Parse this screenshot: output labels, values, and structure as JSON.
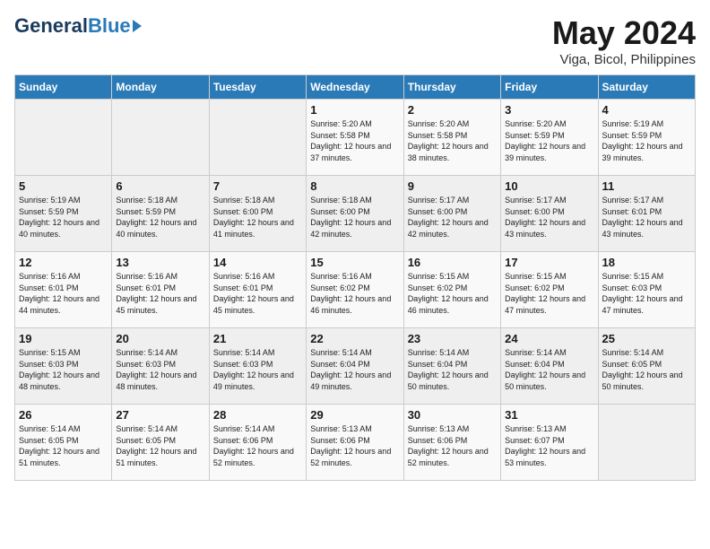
{
  "header": {
    "logo_general": "General",
    "logo_blue": "Blue",
    "month_title": "May 2024",
    "location": "Viga, Bicol, Philippines"
  },
  "calendar": {
    "weekdays": [
      "Sunday",
      "Monday",
      "Tuesday",
      "Wednesday",
      "Thursday",
      "Friday",
      "Saturday"
    ],
    "weeks": [
      [
        {
          "day": "",
          "sunrise": "",
          "sunset": "",
          "daylight": ""
        },
        {
          "day": "",
          "sunrise": "",
          "sunset": "",
          "daylight": ""
        },
        {
          "day": "",
          "sunrise": "",
          "sunset": "",
          "daylight": ""
        },
        {
          "day": "1",
          "sunrise": "5:20 AM",
          "sunset": "5:58 PM",
          "daylight": "12 hours and 37 minutes."
        },
        {
          "day": "2",
          "sunrise": "5:20 AM",
          "sunset": "5:58 PM",
          "daylight": "12 hours and 38 minutes."
        },
        {
          "day": "3",
          "sunrise": "5:20 AM",
          "sunset": "5:59 PM",
          "daylight": "12 hours and 39 minutes."
        },
        {
          "day": "4",
          "sunrise": "5:19 AM",
          "sunset": "5:59 PM",
          "daylight": "12 hours and 39 minutes."
        }
      ],
      [
        {
          "day": "5",
          "sunrise": "5:19 AM",
          "sunset": "5:59 PM",
          "daylight": "12 hours and 40 minutes."
        },
        {
          "day": "6",
          "sunrise": "5:18 AM",
          "sunset": "5:59 PM",
          "daylight": "12 hours and 40 minutes."
        },
        {
          "day": "7",
          "sunrise": "5:18 AM",
          "sunset": "6:00 PM",
          "daylight": "12 hours and 41 minutes."
        },
        {
          "day": "8",
          "sunrise": "5:18 AM",
          "sunset": "6:00 PM",
          "daylight": "12 hours and 42 minutes."
        },
        {
          "day": "9",
          "sunrise": "5:17 AM",
          "sunset": "6:00 PM",
          "daylight": "12 hours and 42 minutes."
        },
        {
          "day": "10",
          "sunrise": "5:17 AM",
          "sunset": "6:00 PM",
          "daylight": "12 hours and 43 minutes."
        },
        {
          "day": "11",
          "sunrise": "5:17 AM",
          "sunset": "6:01 PM",
          "daylight": "12 hours and 43 minutes."
        }
      ],
      [
        {
          "day": "12",
          "sunrise": "5:16 AM",
          "sunset": "6:01 PM",
          "daylight": "12 hours and 44 minutes."
        },
        {
          "day": "13",
          "sunrise": "5:16 AM",
          "sunset": "6:01 PM",
          "daylight": "12 hours and 45 minutes."
        },
        {
          "day": "14",
          "sunrise": "5:16 AM",
          "sunset": "6:01 PM",
          "daylight": "12 hours and 45 minutes."
        },
        {
          "day": "15",
          "sunrise": "5:16 AM",
          "sunset": "6:02 PM",
          "daylight": "12 hours and 46 minutes."
        },
        {
          "day": "16",
          "sunrise": "5:15 AM",
          "sunset": "6:02 PM",
          "daylight": "12 hours and 46 minutes."
        },
        {
          "day": "17",
          "sunrise": "5:15 AM",
          "sunset": "6:02 PM",
          "daylight": "12 hours and 47 minutes."
        },
        {
          "day": "18",
          "sunrise": "5:15 AM",
          "sunset": "6:03 PM",
          "daylight": "12 hours and 47 minutes."
        }
      ],
      [
        {
          "day": "19",
          "sunrise": "5:15 AM",
          "sunset": "6:03 PM",
          "daylight": "12 hours and 48 minutes."
        },
        {
          "day": "20",
          "sunrise": "5:14 AM",
          "sunset": "6:03 PM",
          "daylight": "12 hours and 48 minutes."
        },
        {
          "day": "21",
          "sunrise": "5:14 AM",
          "sunset": "6:03 PM",
          "daylight": "12 hours and 49 minutes."
        },
        {
          "day": "22",
          "sunrise": "5:14 AM",
          "sunset": "6:04 PM",
          "daylight": "12 hours and 49 minutes."
        },
        {
          "day": "23",
          "sunrise": "5:14 AM",
          "sunset": "6:04 PM",
          "daylight": "12 hours and 50 minutes."
        },
        {
          "day": "24",
          "sunrise": "5:14 AM",
          "sunset": "6:04 PM",
          "daylight": "12 hours and 50 minutes."
        },
        {
          "day": "25",
          "sunrise": "5:14 AM",
          "sunset": "6:05 PM",
          "daylight": "12 hours and 50 minutes."
        }
      ],
      [
        {
          "day": "26",
          "sunrise": "5:14 AM",
          "sunset": "6:05 PM",
          "daylight": "12 hours and 51 minutes."
        },
        {
          "day": "27",
          "sunrise": "5:14 AM",
          "sunset": "6:05 PM",
          "daylight": "12 hours and 51 minutes."
        },
        {
          "day": "28",
          "sunrise": "5:14 AM",
          "sunset": "6:06 PM",
          "daylight": "12 hours and 52 minutes."
        },
        {
          "day": "29",
          "sunrise": "5:13 AM",
          "sunset": "6:06 PM",
          "daylight": "12 hours and 52 minutes."
        },
        {
          "day": "30",
          "sunrise": "5:13 AM",
          "sunset": "6:06 PM",
          "daylight": "12 hours and 52 minutes."
        },
        {
          "day": "31",
          "sunrise": "5:13 AM",
          "sunset": "6:07 PM",
          "daylight": "12 hours and 53 minutes."
        },
        {
          "day": "",
          "sunrise": "",
          "sunset": "",
          "daylight": ""
        }
      ]
    ]
  }
}
